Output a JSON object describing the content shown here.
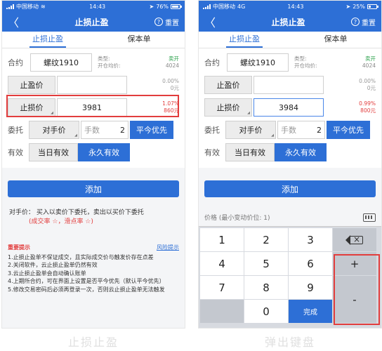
{
  "left": {
    "status": {
      "carrier": "中国移动",
      "time": "14:43",
      "battery": "76%",
      "battery_level": 0.76
    },
    "nav": {
      "back": "〈",
      "title": "止损止盈",
      "help": "?",
      "reset": "重置"
    },
    "tabs": [
      "止损止盈",
      "保本单"
    ],
    "contract": {
      "label": "合约",
      "value": "螺纹1910",
      "type_label": "类型:",
      "type_value": "卖开",
      "open_label": "开仓均价:",
      "open_value": "4024"
    },
    "take_profit": {
      "label": "止盈价",
      "pct": "0.00%",
      "amt": "0元"
    },
    "stop_loss": {
      "label": "止损价",
      "value": "3981",
      "pct": "1.07%",
      "amt": "860元"
    },
    "order": {
      "label": "委托",
      "type": "对手价",
      "qty_placeholder": "手数",
      "qty": "2",
      "priority": "平今优先"
    },
    "valid": {
      "label": "有效",
      "today": "当日有效",
      "forever": "永久有效"
    },
    "add": "添加",
    "note": {
      "line1": "对手价：  买入以卖价下委托，卖出以买价下委托",
      "line2": "(成交率 ☆，滑点率 ☆)"
    },
    "tips": {
      "title": "重要提示",
      "risk": "风险提示",
      "items": [
        "1.止损止盈单不保证成交，且实际成交价与触发价存在点差",
        "2.关闭软件，云止损止盈单仍然有效",
        "3.云止损止盈单会自动确认账单",
        "4.上期所合约，可在界面上设置是否平今优先（默认平今优先）",
        "5.修改交易密码后必须再登录一次，否则云止损止盈单无法触发"
      ]
    },
    "caption": "止损止盈"
  },
  "right": {
    "status": {
      "carrier": "中国移动",
      "network": "4G",
      "time": "14:43",
      "battery": "25%",
      "battery_level": 0.25
    },
    "nav": {
      "back": "〈",
      "title": "止损止盈",
      "help": "?",
      "reset": "重置"
    },
    "tabs": [
      "止损止盈",
      "保本单"
    ],
    "contract": {
      "label": "合约",
      "value": "螺纹1910",
      "type_label": "类型:",
      "type_value": "卖开",
      "open_label": "开仓均价:",
      "open_value": "4024"
    },
    "take_profit": {
      "label": "止盈价",
      "pct": "0.00%",
      "amt": "0元"
    },
    "stop_loss": {
      "label": "止损价",
      "value": "3984",
      "pct": "0.99%",
      "amt": "800元"
    },
    "order": {
      "label": "委托",
      "type": "对手价",
      "qty_placeholder": "手数",
      "qty": "2",
      "priority": "平今优先"
    },
    "valid": {
      "label": "有效",
      "today": "当日有效",
      "forever": "永久有效"
    },
    "add": "添加",
    "keyboard": {
      "hint": "价格 (最小变动价位: 1)",
      "keys": [
        "1",
        "2",
        "3",
        "4",
        "5",
        "6",
        "7",
        "8",
        "9",
        "0",
        "完成",
        "+",
        "-"
      ]
    },
    "caption": "弹出键盘"
  },
  "colors": {
    "primary": "#2d6fd6",
    "highlight": "#e23d3d",
    "green": "#2ba14b"
  }
}
